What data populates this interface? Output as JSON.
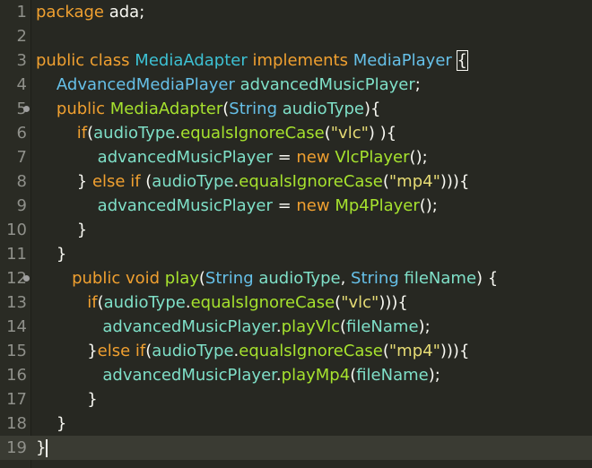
{
  "editor": {
    "lines": [
      {
        "n": "1",
        "tokens": [
          [
            "kw",
            "package"
          ],
          [
            "pun",
            " ada;"
          ]
        ]
      },
      {
        "n": "2",
        "tokens": []
      },
      {
        "n": "3",
        "tokens": [
          [
            "kw",
            "public class "
          ],
          [
            "cls",
            "MediaAdapter "
          ],
          [
            "kw",
            "implements "
          ],
          [
            "ty",
            "MediaPlayer "
          ],
          [
            "pun",
            "{"
          ]
        ]
      },
      {
        "n": "4",
        "tokens": [
          [
            "pun",
            "    "
          ],
          [
            "ty",
            "AdvancedMediaPlayer "
          ],
          [
            "var",
            "advancedMusicPlayer"
          ],
          [
            "pun",
            ";"
          ]
        ]
      },
      {
        "n": "5",
        "fold": true,
        "tokens": [
          [
            "pun",
            "    "
          ],
          [
            "kw",
            "public "
          ],
          [
            "fn",
            "MediaAdapter"
          ],
          [
            "pun",
            "("
          ],
          [
            "ty",
            "String "
          ],
          [
            "var",
            "audioType"
          ],
          [
            "pun",
            "){"
          ]
        ]
      },
      {
        "n": "6",
        "tokens": [
          [
            "pun",
            "        "
          ],
          [
            "kw",
            "if"
          ],
          [
            "pun",
            "("
          ],
          [
            "var",
            "audioType"
          ],
          [
            "pun",
            "."
          ],
          [
            "fn",
            "equalsIgnoreCase"
          ],
          [
            "pun",
            "("
          ],
          [
            "str",
            "\"vlc\""
          ],
          [
            "pun",
            ") ){"
          ]
        ]
      },
      {
        "n": "7",
        "tokens": [
          [
            "pun",
            "            "
          ],
          [
            "var",
            "advancedMusicPlayer"
          ],
          [
            "pun",
            " = "
          ],
          [
            "kw",
            "new "
          ],
          [
            "fn",
            "VlcPlayer"
          ],
          [
            "pun",
            "();"
          ]
        ]
      },
      {
        "n": "8",
        "tokens": [
          [
            "pun",
            "        } "
          ],
          [
            "kw",
            "else if "
          ],
          [
            "pun",
            "("
          ],
          [
            "var",
            "audioType"
          ],
          [
            "pun",
            "."
          ],
          [
            "fn",
            "equalsIgnoreCase"
          ],
          [
            "pun",
            "("
          ],
          [
            "str",
            "\"mp4\""
          ],
          [
            "pun",
            "))){"
          ]
        ]
      },
      {
        "n": "9",
        "tokens": [
          [
            "pun",
            "            "
          ],
          [
            "var",
            "advancedMusicPlayer"
          ],
          [
            "pun",
            " = "
          ],
          [
            "kw",
            "new "
          ],
          [
            "fn",
            "Mp4Player"
          ],
          [
            "pun",
            "();"
          ]
        ]
      },
      {
        "n": "10",
        "tokens": [
          [
            "pun",
            "        }"
          ]
        ]
      },
      {
        "n": "11",
        "tokens": [
          [
            "pun",
            "    }"
          ]
        ]
      },
      {
        "n": "12",
        "fold": true,
        "tokens": [
          [
            "pun",
            "       "
          ],
          [
            "kw",
            "public void "
          ],
          [
            "fn",
            "play"
          ],
          [
            "pun",
            "("
          ],
          [
            "ty",
            "String "
          ],
          [
            "var",
            "audioType"
          ],
          [
            "pun",
            ", "
          ],
          [
            "ty",
            "String "
          ],
          [
            "var",
            "fileName"
          ],
          [
            "pun",
            ") {"
          ]
        ]
      },
      {
        "n": "13",
        "tokens": [
          [
            "pun",
            "          "
          ],
          [
            "kw",
            "if"
          ],
          [
            "pun",
            "("
          ],
          [
            "var",
            "audioType"
          ],
          [
            "pun",
            "."
          ],
          [
            "fn",
            "equalsIgnoreCase"
          ],
          [
            "pun",
            "("
          ],
          [
            "str",
            "\"vlc\""
          ],
          [
            "pun",
            "))){"
          ]
        ]
      },
      {
        "n": "14",
        "tokens": [
          [
            "pun",
            "             "
          ],
          [
            "var",
            "advancedMusicPlayer"
          ],
          [
            "pun",
            "."
          ],
          [
            "fn",
            "playVlc"
          ],
          [
            "pun",
            "("
          ],
          [
            "var",
            "fileName"
          ],
          [
            "pun",
            ");"
          ]
        ]
      },
      {
        "n": "15",
        "tokens": [
          [
            "pun",
            "          }"
          ],
          [
            "kw",
            "else if"
          ],
          [
            "pun",
            "("
          ],
          [
            "var",
            "audioType"
          ],
          [
            "pun",
            "."
          ],
          [
            "fn",
            "equalsIgnoreCase"
          ],
          [
            "pun",
            "("
          ],
          [
            "str",
            "\"mp4\""
          ],
          [
            "pun",
            "))){"
          ]
        ]
      },
      {
        "n": "16",
        "tokens": [
          [
            "pun",
            "             "
          ],
          [
            "var",
            "advancedMusicPlayer"
          ],
          [
            "pun",
            "."
          ],
          [
            "fn",
            "playMp4"
          ],
          [
            "pun",
            "("
          ],
          [
            "var",
            "fileName"
          ],
          [
            "pun",
            ");"
          ]
        ]
      },
      {
        "n": "17",
        "tokens": [
          [
            "pun",
            "          }"
          ]
        ]
      },
      {
        "n": "18",
        "tokens": [
          [
            "pun",
            "    }"
          ]
        ]
      },
      {
        "n": "19",
        "current": true,
        "tokens": [
          [
            "pun",
            "}"
          ]
        ]
      }
    ]
  }
}
